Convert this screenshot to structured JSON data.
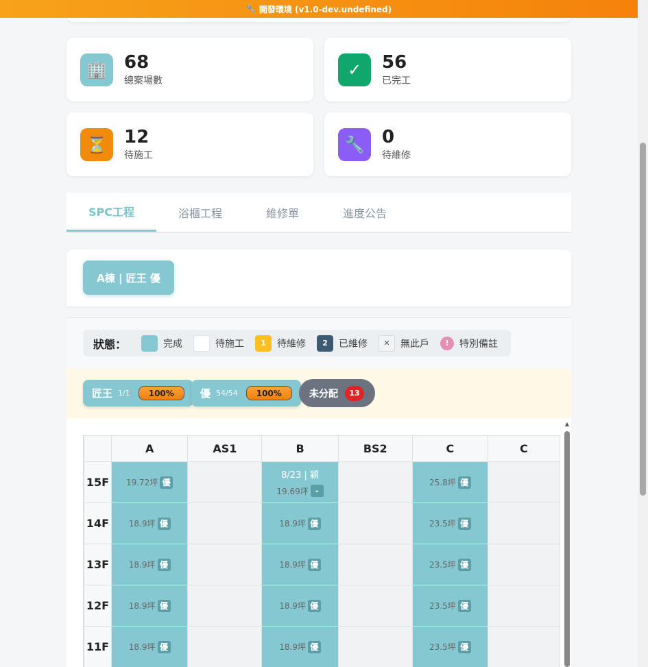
{
  "banner": {
    "icon": "🔧",
    "text": "開發環境 (v1.0-dev.undefined)"
  },
  "stats": [
    {
      "value": "68",
      "label": "總案場數",
      "icon": "🏢",
      "color": "#86c8d1"
    },
    {
      "value": "56",
      "label": "已完工",
      "icon": "✓",
      "color": "#10a86a"
    },
    {
      "value": "12",
      "label": "待施工",
      "icon": "⏳",
      "color": "#f08b0c"
    },
    {
      "value": "0",
      "label": "待維修",
      "icon": "🔧",
      "color": "#8b5cf6"
    }
  ],
  "tabs": [
    "SPC工程",
    "浴櫃工程",
    "維修單",
    "進度公告"
  ],
  "active_tab": "SPC工程",
  "building": {
    "label": "A棟 | 匠王 優"
  },
  "legend": {
    "title": "狀態：",
    "items": [
      {
        "label": "完成",
        "swatch": "",
        "color": "#86c8d1"
      },
      {
        "label": "待施工",
        "swatch": "",
        "color": "#ffffff"
      },
      {
        "label": "待維修",
        "swatch": "1",
        "color": "#fbbf24"
      },
      {
        "label": "已維修",
        "swatch": "2",
        "color": "#3d5a73"
      },
      {
        "label": "無此戶",
        "swatch": "✕",
        "color": "#f3f4f6"
      },
      {
        "label": "特別備註",
        "swatch": "!",
        "color": "#e68fb4"
      }
    ]
  },
  "assignees": [
    {
      "name": "匠王",
      "count": "1/1",
      "pct": "100%"
    },
    {
      "name": "優",
      "count": "54/54",
      "pct": "100%"
    }
  ],
  "unassigned": {
    "label": "未分配",
    "count": "13"
  },
  "grid": {
    "columns": [
      "A",
      "AS1",
      "B",
      "BS2",
      "C",
      "C"
    ],
    "rows": [
      {
        "floor": "15F",
        "cells": [
          {
            "status": "done",
            "size": "19.72坪",
            "tag": "優"
          },
          {
            "status": "empty"
          },
          {
            "status": "done",
            "note": "8/23 | 穎",
            "size": "19.69坪",
            "tag": "-"
          },
          {
            "status": "empty"
          },
          {
            "status": "done",
            "size": "25.8坪",
            "tag": "優"
          },
          {
            "status": "empty"
          }
        ]
      },
      {
        "floor": "14F",
        "cells": [
          {
            "status": "done",
            "size": "18.9坪",
            "tag": "優"
          },
          {
            "status": "empty"
          },
          {
            "status": "done",
            "size": "18.9坪",
            "tag": "優"
          },
          {
            "status": "empty"
          },
          {
            "status": "done",
            "size": "23.5坪",
            "tag": "優"
          },
          {
            "status": "empty"
          }
        ]
      },
      {
        "floor": "13F",
        "cells": [
          {
            "status": "done",
            "size": "18.9坪",
            "tag": "優"
          },
          {
            "status": "empty"
          },
          {
            "status": "done",
            "size": "18.9坪",
            "tag": "優"
          },
          {
            "status": "empty"
          },
          {
            "status": "done",
            "size": "23.5坪",
            "tag": "優"
          },
          {
            "status": "empty"
          }
        ]
      },
      {
        "floor": "12F",
        "cells": [
          {
            "status": "done",
            "size": "18.9坪",
            "tag": "優"
          },
          {
            "status": "empty"
          },
          {
            "status": "done",
            "size": "18.9坪",
            "tag": "優"
          },
          {
            "status": "empty"
          },
          {
            "status": "done",
            "size": "23.5坪",
            "tag": "優"
          },
          {
            "status": "empty"
          }
        ]
      },
      {
        "floor": "11F",
        "cells": [
          {
            "status": "done",
            "size": "18.9坪",
            "tag": "優"
          },
          {
            "status": "empty"
          },
          {
            "status": "done",
            "size": "18.9坪",
            "tag": "優"
          },
          {
            "status": "empty"
          },
          {
            "status": "done",
            "size": "23.5坪",
            "tag": "優"
          },
          {
            "status": "empty"
          }
        ]
      }
    ]
  }
}
